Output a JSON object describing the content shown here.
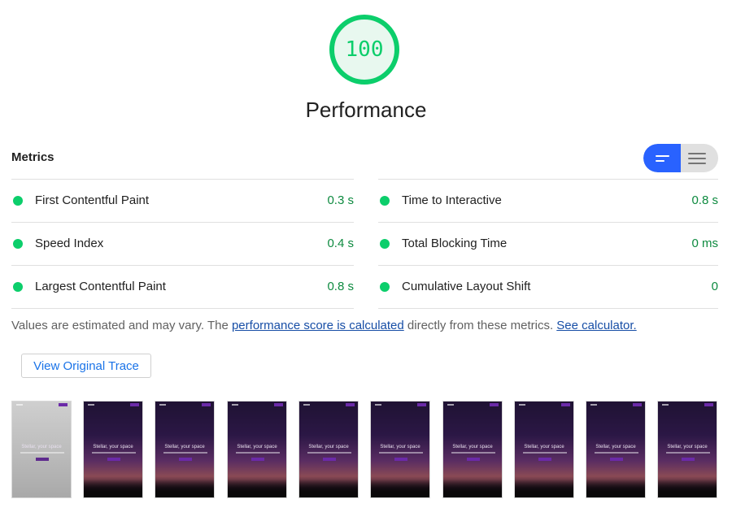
{
  "score": {
    "value": "100",
    "label": "Performance",
    "color": "#0cce6b",
    "fraction": 1.0
  },
  "metrics": {
    "header": "Metrics",
    "toggle_icons": [
      "expanded-view-icon",
      "collapsed-view-icon"
    ],
    "left": [
      {
        "name": "First Contentful Paint",
        "value": "0.3 s"
      },
      {
        "name": "Speed Index",
        "value": "0.4 s"
      },
      {
        "name": "Largest Contentful Paint",
        "value": "0.8 s"
      }
    ],
    "right": [
      {
        "name": "Time to Interactive",
        "value": "0.8 s"
      },
      {
        "name": "Total Blocking Time",
        "value": "0 ms"
      },
      {
        "name": "Cumulative Layout Shift",
        "value": "0"
      }
    ]
  },
  "footnote": {
    "prefix": "Values are estimated and may vary. The ",
    "link1": "performance score is calculated",
    "middle": " directly from these metrics. ",
    "link2": "See calculator."
  },
  "trace_button": "View Original Trace",
  "filmstrip": {
    "frame_title": "Stellar, your space",
    "frames": 10
  }
}
